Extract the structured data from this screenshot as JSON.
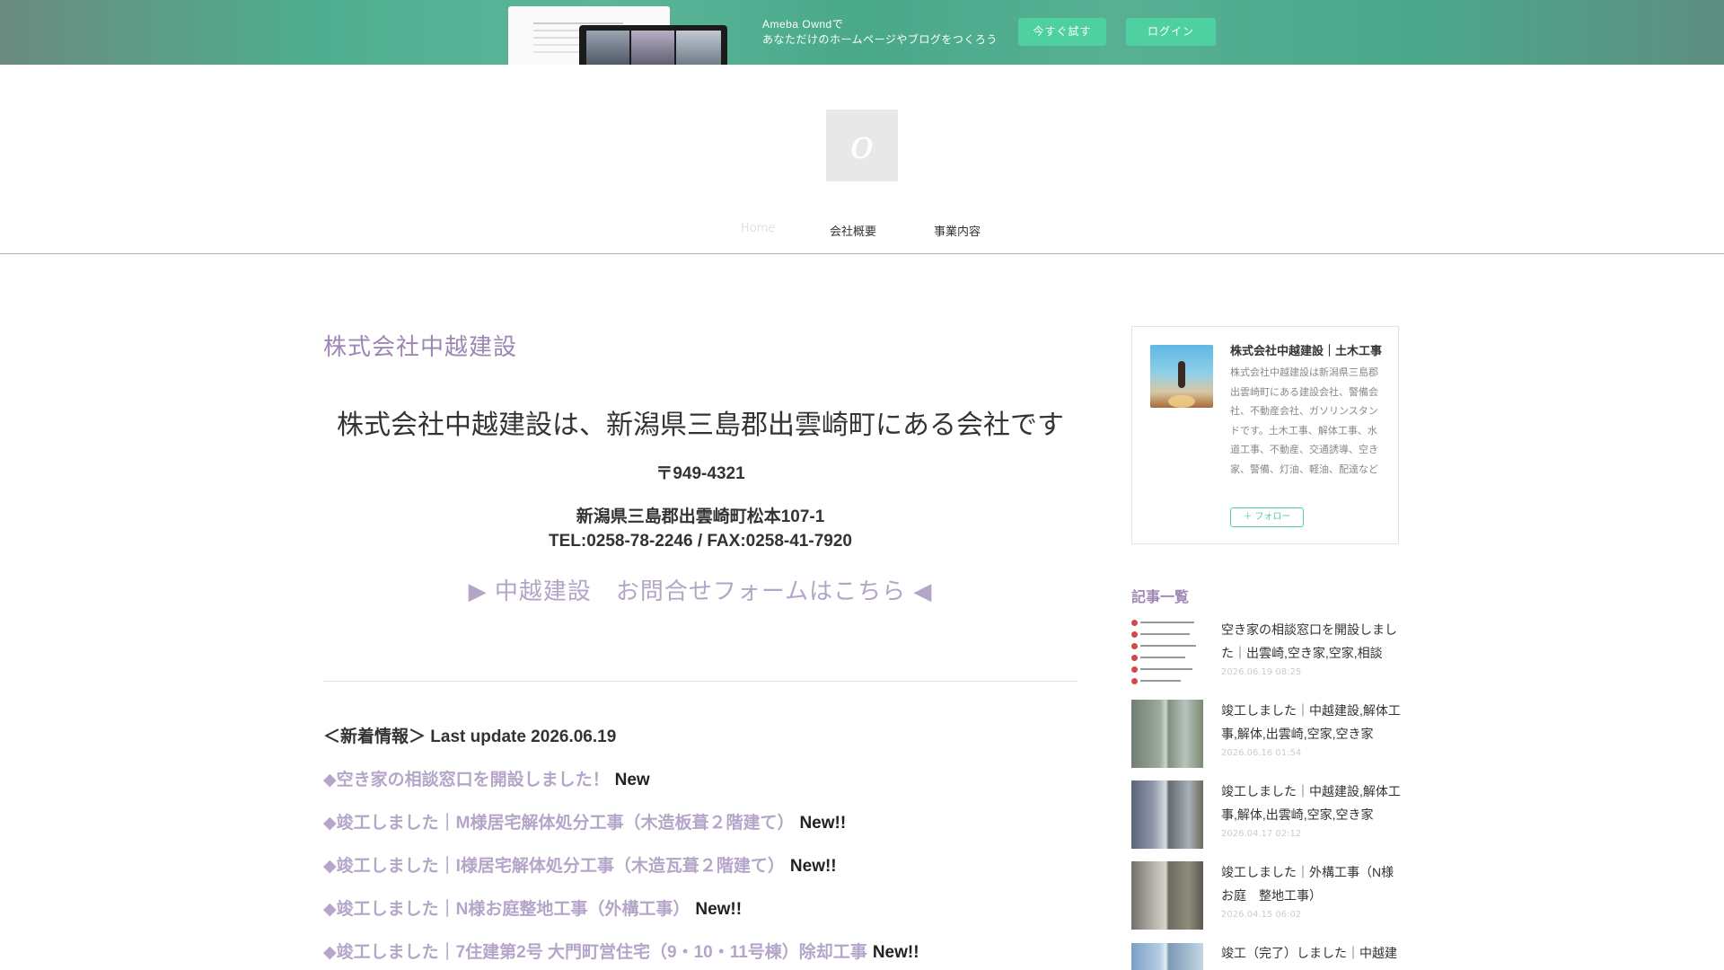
{
  "promo": {
    "line1": "Ameba Owndで",
    "line2": "あなただけのホームページやブログをつくろう",
    "try_label": "今すぐ試す",
    "login_label": "ログイン"
  },
  "header": {
    "logo_char": "o",
    "nav": [
      {
        "label": "Home"
      },
      {
        "label": "会社概要"
      },
      {
        "label": "事業内容"
      }
    ]
  },
  "main": {
    "page_title": "株式会社中越建設",
    "headline": "株式会社中越建設は、新潟県三島郡出雲崎町にある会社です",
    "postal": "〒949-4321",
    "address": "新潟県三島郡出雲崎町松本107-1",
    "tel_fax": "TEL:0258-78-2246 / FAX:0258-41-7920",
    "form_link": "▶ 中越建設　お問合せフォームはこちら ◀",
    "news_heading": "＜新着情報＞ Last update 2026.06.19",
    "news": [
      {
        "text": "◆空き家の相談窓口を開設しました！",
        "tag": "New"
      },
      {
        "text": "◆竣工しました｜M様居宅解体処分工事（木造板葺２階建て）",
        "tag": "New!!"
      },
      {
        "text": "◆竣工しました｜I様居宅解体処分工事（木造瓦葺２階建て）",
        "tag": "New!!"
      },
      {
        "text": "◆竣工しました｜N様お庭整地工事（外構工事）",
        "tag": "New!!"
      },
      {
        "text": "◆竣工しました｜7住建第2号 大門町営住宅（9・10・11号棟）除却工事",
        "tag": "New!!"
      }
    ]
  },
  "sidebar": {
    "profile": {
      "name": "株式会社中越建設｜土木工事",
      "description": "株式会社中越建設は新潟県三島郡出雲崎町にある建設会社、警備会社、不動産会社、ガソリンスタンドです。土木工事、解体工事、水道工事、不動産、交通誘導、空き家、警備、灯油、軽油、配達など",
      "follow_label": "＋ フォロー"
    },
    "articles_title": "記事一覧",
    "articles": [
      {
        "title": "空き家の相談窓口を開設しました｜出雲崎,空き家,空家,相談",
        "date": "2026.06.19 08:25"
      },
      {
        "title": "竣工しました｜中越建設,解体工事,解体,出雲崎,空家,空き家",
        "date": "2026.06.16 01:54"
      },
      {
        "title": "竣工しました｜中越建設,解体工事,解体,出雲崎,空家,空き家",
        "date": "2026.04.17 02:12"
      },
      {
        "title": "竣工しました｜外構工事（N様お庭　整地工事）",
        "date": "2026.04.15 06:02"
      },
      {
        "title": "竣工（完了）しました｜中越建",
        "date": ""
      }
    ]
  }
}
